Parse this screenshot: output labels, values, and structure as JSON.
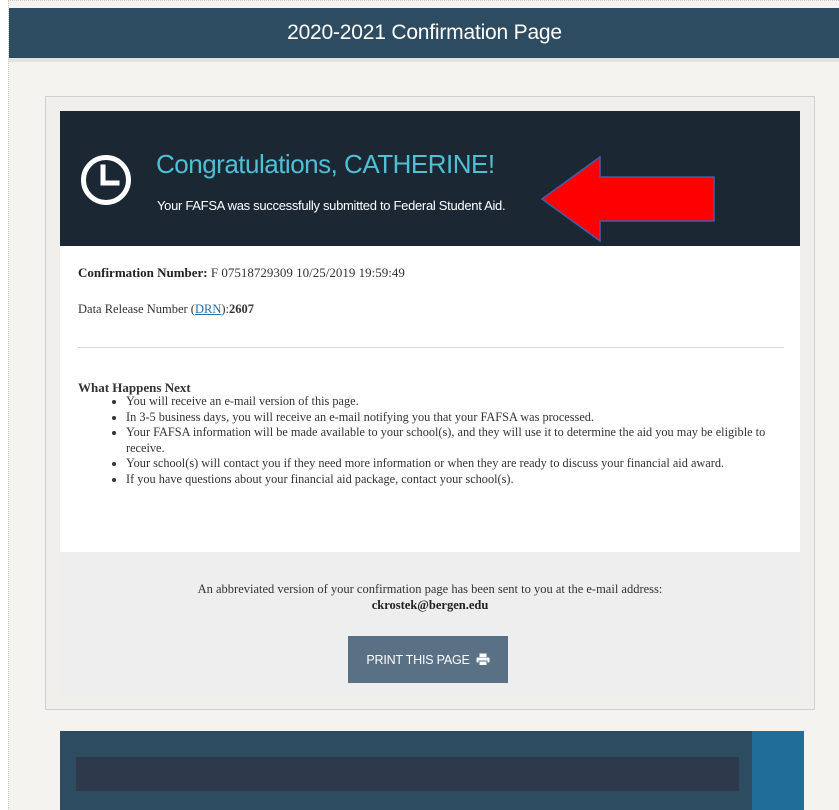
{
  "header": {
    "title": "2020-2021 Confirmation Page"
  },
  "hero": {
    "title": "Congratulations, CATHERINE!",
    "subtitle": "Your FAFSA was successfully submitted to Federal Student Aid."
  },
  "confirmation": {
    "number_label": "Confirmation Number:",
    "number_value": "F 07518729309 10/25/2019 19:59:49",
    "drn_prefix": "Data Release Number (",
    "drn_link": "DRN",
    "drn_suffix": "):",
    "drn_value": "2607"
  },
  "next_steps": {
    "title": "What Happens Next",
    "items": [
      "You will receive an e-mail version of this page.",
      "In 3-5 business days, you will receive an e-mail notifying you that your FAFSA was processed.",
      "Your FAFSA information will be made available to your school(s), and they will use it to determine the aid you may be eligible to receive.",
      "Your school(s) will contact you if they need more information or when they are ready to discuss your financial aid award.",
      "If you have questions about your financial aid package, contact your school(s)."
    ]
  },
  "email_notice": {
    "text": "An abbreviated version of your confirmation page has been sent to you at the e-mail address:",
    "address": "ckrostek@bergen.edu"
  },
  "print_button": {
    "label": "PRINT THIS PAGE"
  },
  "colors": {
    "header_bg": "#2d4b61",
    "hero_bg": "#1b2834",
    "hero_title": "#4fbfd6",
    "arrow": "#ff0000",
    "button_bg": "#597085",
    "link": "#2a6fa8"
  }
}
